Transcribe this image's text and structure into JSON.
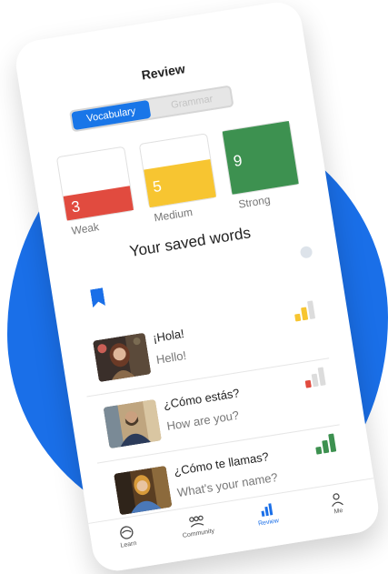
{
  "header": {
    "title": "Review"
  },
  "tabs": {
    "active": "Vocabulary",
    "inactive": "Grammar"
  },
  "strength": [
    {
      "count": "3",
      "label": "Weak",
      "color": "#e14b3f",
      "fill": 0.38
    },
    {
      "count": "5",
      "label": "Medium",
      "color": "#f7c531",
      "fill": 0.6
    },
    {
      "count": "9",
      "label": "Strong",
      "color": "#3d9150",
      "fill": 1.0
    }
  ],
  "saved": {
    "title": "Your saved words"
  },
  "words": [
    {
      "phrase": "¡Hola!",
      "translation": "Hello!",
      "strength": "medium",
      "bar_color": "#f7c531"
    },
    {
      "phrase": "¿Cómo estás?",
      "translation": "How are you?",
      "strength": "weak",
      "bar_color": "#e14b3f"
    },
    {
      "phrase": "¿Cómo te llamas?",
      "translation": "What's your name?",
      "strength": "strong",
      "bar_color": "#3d9150"
    }
  ],
  "nav": [
    {
      "label": "Learn",
      "icon": "learn-icon"
    },
    {
      "label": "Community",
      "icon": "community-icon"
    },
    {
      "label": "Review",
      "icon": "review-icon"
    },
    {
      "label": "Me",
      "icon": "profile-icon"
    }
  ]
}
